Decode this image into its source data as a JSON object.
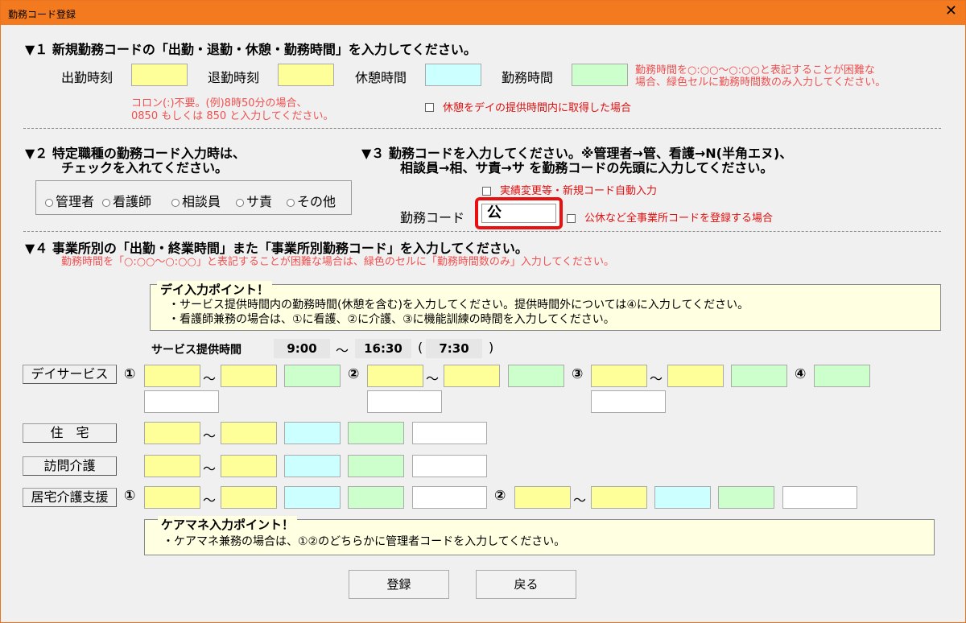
{
  "window": {
    "title": "勤務コード登録",
    "close_glyph": "✕"
  },
  "sec1": {
    "heading": "▼１ 新規勤務コードの「出勤・退勤・休憩・勤務時間」を入力してください。",
    "label_in": "出勤時刻",
    "label_out": "退勤時刻",
    "label_break": "休憩時間",
    "label_work": "勤務時間",
    "note_work_line1": "勤務時間を○:○○〜○:○○と表記することが困難な",
    "note_work_line2": "場合、緑色セルに勤務時間数のみ入力してください。",
    "note_colon_line1": "コロン(:)不要。(例)8時50分の場合、",
    "note_colon_line2": "0850 もしくは 850 と入力してください。",
    "check_break": "休憩をデイの提供時間内に取得した場合"
  },
  "sec2": {
    "heading_line1": "▼２ 特定職種の勤務コード入力時は、",
    "heading_line2": "チェックを入れてください。",
    "radios": [
      "管理者",
      "看護師",
      "相談員",
      "サ責",
      "その他"
    ]
  },
  "sec3": {
    "heading_line1": "▼３ 勤務コードを入力してください。※管理者→管、看護→N(半角エヌ)、",
    "heading_line2": "相談員→相、サ責→サ を勤務コードの先頭に入力してください。",
    "check_auto": "実績変更等・新規コード自動入力",
    "code_label": "勤務コード",
    "code_value": "公",
    "check_all": "公休など全事業所コードを登録する場合"
  },
  "sec4": {
    "heading": "▼４ 事業所別の「出勤・終業時間」また「事業所別勤務コード」を入力してください。",
    "note": "勤務時間を「○:○○〜○:○○」と表記することが困難な場合は、緑色のセルに「勤務時間数のみ」入力してください。",
    "day_point": {
      "title": "デイ入力ポイント！",
      "line1": "・サービス提供時間内の勤務時間(休憩を含む)を入力してください。提供時間外については④に入力してください。",
      "line2": "・看護師兼務の場合は、①に看護、②に介護、③に機能訓練の時間を入力してください。"
    },
    "service_time": {
      "label": "サービス提供時間",
      "start": "9:00",
      "tilde": "〜",
      "end": "16:30",
      "paren_open": "(",
      "duration": "7:30",
      "paren_close": ")"
    },
    "rows": {
      "day": "デイサービス",
      "home": "住　宅",
      "visit": "訪問介護",
      "care": "居宅介護支援"
    },
    "marks": {
      "m1": "①",
      "m2": "②",
      "m3": "③",
      "m4": "④",
      "tilde": "〜"
    },
    "care_point": {
      "title": "ケアマネ入力ポイント！",
      "line1": "・ケアマネ兼務の場合は、①②のどちらかに管理者コードを入力してください。"
    }
  },
  "buttons": {
    "register": "登録",
    "back": "戻る"
  }
}
